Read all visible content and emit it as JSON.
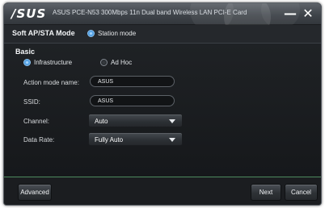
{
  "window": {
    "logo_text": "/SUS",
    "title": "ASUS PCE-N53 300Mbps 11n Dual band Wireless LAN PCI-E Card",
    "minimize_label": "—",
    "close_label": "✕"
  },
  "mode": {
    "label": "Soft AP/STA Mode",
    "station_option": "Station mode",
    "station_selected": true
  },
  "basic": {
    "heading": "Basic",
    "network_type": {
      "infrastructure_label": "Infrastructure",
      "adhoc_label": "Ad Hoc",
      "selected": "Infrastructure"
    },
    "action_mode_name": {
      "label": "Action mode name:",
      "value": "ASUS"
    },
    "ssid": {
      "label": "SSID:",
      "value": "ASUS"
    },
    "channel": {
      "label": "Channel:",
      "value": "Auto"
    },
    "data_rate": {
      "label": "Data Rate:",
      "value": "Fully Auto"
    }
  },
  "buttons": {
    "advanced": "Advanced",
    "next": "Next",
    "cancel": "Cancel"
  },
  "colors": {
    "accent_radio": "#5aa9ec",
    "divider_green": "#4e8a5e",
    "window_bg": "#1b1d20"
  }
}
